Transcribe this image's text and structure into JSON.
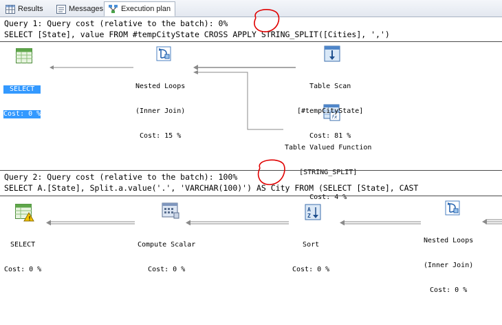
{
  "tabs": [
    {
      "label": "Results",
      "icon": "grid-icon",
      "active": false
    },
    {
      "label": "Messages",
      "icon": "messages-icon",
      "active": false
    },
    {
      "label": "Execution plan",
      "icon": "execution-plan-icon",
      "active": true
    }
  ],
  "queries": [
    {
      "header": "Query 1: Query cost (relative to the batch): 0%",
      "sql": "SELECT [State], value FROM #tempCityState CROSS APPLY STRING_SPLIT([Cities], ',')",
      "nodes": {
        "select": {
          "title": "SELECT",
          "cost": "Cost: 0 %"
        },
        "nested_loops": {
          "title": "Nested Loops",
          "sub": "(Inner Join)",
          "cost": "Cost: 15 %"
        },
        "table_scan": {
          "title": "Table Scan",
          "sub": "[#tempCityState]",
          "cost": "Cost: 81 %"
        },
        "tvf": {
          "title": "Table Valued Function",
          "sub": "[STRING_SPLIT]",
          "cost": "Cost: 4 %"
        }
      }
    },
    {
      "header": "Query 2: Query cost (relative to the batch): 100%",
      "sql": "SELECT A.[State], Split.a.value('.', 'VARCHAR(100)') AS City FROM (SELECT [State], CAST",
      "nodes": {
        "select": {
          "title": "SELECT",
          "cost": "Cost: 0 %"
        },
        "compute_scalar": {
          "title": "Compute Scalar",
          "cost": "Cost: 0 %"
        },
        "sort": {
          "title": "Sort",
          "cost": "Cost: 0 %"
        },
        "nested_loops": {
          "title": "Nested Loops",
          "sub": "(Inner Join)",
          "cost": "Cost: 0 %"
        }
      }
    }
  ],
  "colors": {
    "selection": "#3399ff",
    "annotation": "#e00000",
    "warning": "#f5c400"
  }
}
